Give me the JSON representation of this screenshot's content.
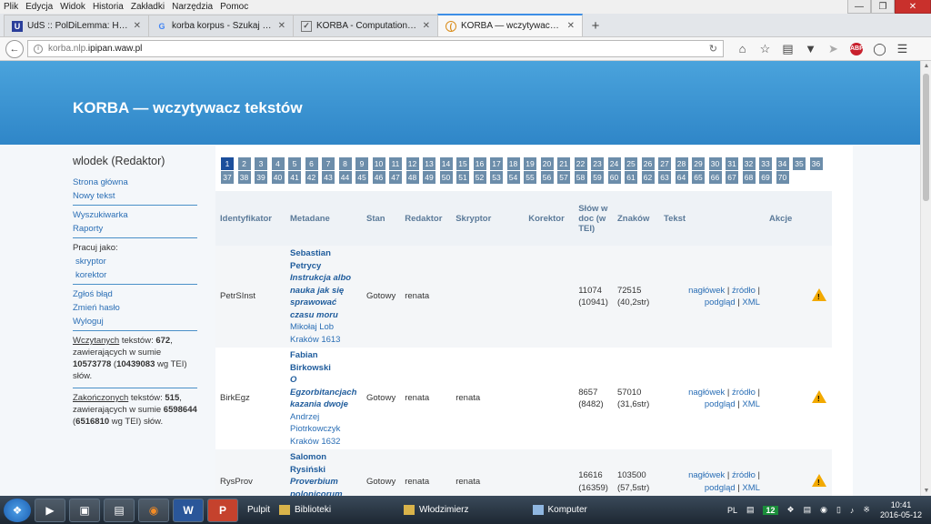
{
  "menubar": [
    "Plik",
    "Edycja",
    "Widok",
    "Historia",
    "Zakładki",
    "Narzędzia",
    "Pomoc"
  ],
  "tabs": [
    {
      "label": "UdS :: PolDiLemma: Home",
      "icon": "uds-icon"
    },
    {
      "label": "korba korpus - Szukaj w Go...",
      "icon": "google-icon"
    },
    {
      "label": "KORBA - Computational Li...",
      "icon": "korba-icon"
    },
    {
      "label": "KORBA — wczytywacz teks...",
      "icon": "korba-wczytywacz-icon",
      "active": true
    }
  ],
  "address": {
    "url_prefix": "korba.nlp.",
    "url_domain": "ipipan.waw.pl"
  },
  "page": {
    "title": "KORBA — wczytywacz tekstów"
  },
  "sidebar": {
    "user": "wlodek (Redaktor)",
    "links_top": [
      "Strona główna",
      "Nowy tekst"
    ],
    "links_mid": [
      "Wyszukiwarka",
      "Raporty"
    ],
    "work_as_label": "Pracuj jako:",
    "work_as": [
      "skryptor",
      "korektor"
    ],
    "links_bottom": [
      "Zgłoś błąd",
      "Zmień hasło",
      "Wyloguj"
    ],
    "stat1": {
      "label": "Wczytanych",
      "suffix": " tekstów: ",
      "count": "672",
      "text1": ", zawierających w sumie ",
      "words": "10573778",
      "text2": " (",
      "tei": "10439083",
      "text3": " wg TEI) słów."
    },
    "stat2": {
      "label": "Zakończonych",
      "suffix": " tekstów: ",
      "count": "515",
      "text1": ", zawierających w sumie ",
      "words": "6598644",
      "text2": " (",
      "tei": "6516810",
      "text3": " wg TEI) słów."
    }
  },
  "pager": {
    "pages": [
      "1",
      "2",
      "3",
      "4",
      "5",
      "6",
      "7",
      "8",
      "9",
      "10",
      "11",
      "12",
      "13",
      "14",
      "15",
      "16",
      "17",
      "18",
      "19",
      "20",
      "21",
      "22",
      "23",
      "24",
      "25",
      "26",
      "27",
      "28",
      "29",
      "30",
      "31",
      "32",
      "33",
      "34",
      "35",
      "36",
      "37",
      "38",
      "39",
      "40",
      "41",
      "42",
      "43",
      "44",
      "45",
      "46",
      "47",
      "48",
      "49",
      "50",
      "51",
      "52",
      "53",
      "54",
      "55",
      "56",
      "57",
      "58",
      "59",
      "60",
      "61",
      "62",
      "63",
      "64",
      "65",
      "66",
      "67",
      "68",
      "69",
      "70"
    ],
    "active": "1"
  },
  "table": {
    "headers": {
      "id": "Identyfikator",
      "meta": "Metadane",
      "state": "Stan",
      "editor": "Redaktor",
      "scriptor": "Skryptor",
      "corrector": "Korektor",
      "words": "Słów w doc (w TEI)",
      "chars": "Znaków",
      "text": "Tekst",
      "actions": "Akcje"
    },
    "link_labels": {
      "header": "nagłówek",
      "source": "źródło",
      "preview": "podgląd",
      "xml": "XML"
    },
    "rows": [
      {
        "id": "PetrSInst",
        "author": "Sebastian Petrycy",
        "title": "Instrukcja albo nauka jak się sprawować czasu moru",
        "publisher": "Mikołaj Lob",
        "place": "Kraków 1613",
        "state": "Gotowy",
        "editor": "renata",
        "scriptor": "",
        "corrector": "",
        "words": "11074",
        "words_tei": "(10941)",
        "chars": "72515",
        "chars_pages": "(40,2str)"
      },
      {
        "id": "BirkEgz",
        "author": "Fabian Birkowski",
        "title": "O Egzorbitancjach kazania dwoje",
        "publisher": "Andrzej Piotrkowczyk",
        "place": "Kraków 1632",
        "state": "Gotowy",
        "editor": "renata",
        "scriptor": "renata",
        "corrector": "",
        "words": "8657",
        "words_tei": "(8482)",
        "chars": "57010",
        "chars_pages": "(31,6str)"
      },
      {
        "id": "RysProv",
        "author": "Salomon Rysiński",
        "title": "Proverbium polonicorum",
        "publisher": "",
        "place": "",
        "state": "Gotowy",
        "editor": "renata",
        "scriptor": "renata",
        "corrector": "",
        "words": "16616",
        "words_tei": "(16359)",
        "chars": "103500",
        "chars_pages": "(57,5str)"
      }
    ]
  },
  "taskbar": {
    "pulpit": "Pulpit",
    "items": [
      "Biblioteki",
      "Włodzimierz",
      "Komputer"
    ],
    "lang": "PL",
    "badge": "12",
    "time": "10:41",
    "date": "2016-05-12"
  },
  "colors": {
    "banner": "#3a94d4",
    "link": "#2a6eb5",
    "pager": "#6c8daa",
    "pager_active": "#1c4f9c",
    "warning": "#f2a900"
  }
}
